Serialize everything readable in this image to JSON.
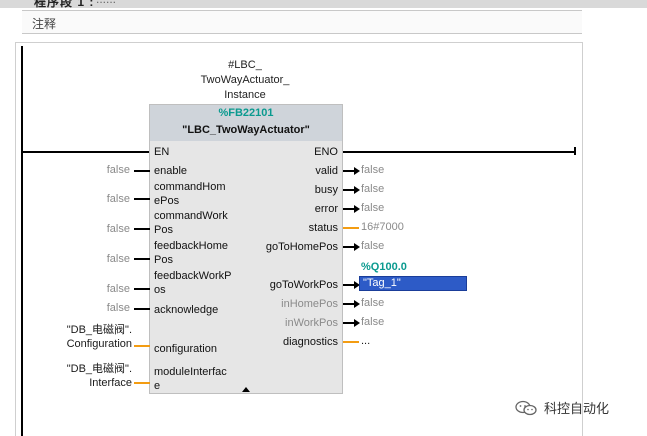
{
  "header": {
    "network_title": "程序段 1 :",
    "network_title_dots": "......",
    "comment_label": "注释"
  },
  "instance": {
    "line1": "#LBC_",
    "line2": "TwoWayActuator_",
    "line3": "Instance"
  },
  "block": {
    "number": "%FB22101",
    "type_name": "\"LBC_TwoWayActuator\"",
    "en_label": "EN",
    "eno_label": "ENO"
  },
  "inputs": [
    {
      "value": "false",
      "pin": [
        "enable"
      ]
    },
    {
      "value": "false",
      "pin": [
        "commandHom",
        "ePos"
      ]
    },
    {
      "value": "false",
      "pin": [
        "commandWork",
        "Pos"
      ]
    },
    {
      "value": "false",
      "pin": [
        "feedbackHome",
        "Pos"
      ]
    },
    {
      "value": "false",
      "pin": [
        "feedbackWorkP",
        "os"
      ]
    },
    {
      "value": "false",
      "pin": [
        "acknowledge"
      ]
    },
    {
      "value": [
        "\"DB_电磁阀\".",
        "Configuration"
      ],
      "pin": [
        "configuration"
      ]
    },
    {
      "value": [
        "\"DB_电磁阀\".",
        "Interface"
      ],
      "pin": [
        "moduleInterfac",
        "e"
      ]
    }
  ],
  "outputs": [
    {
      "pin": "valid",
      "value": "false"
    },
    {
      "pin": "busy",
      "value": "false"
    },
    {
      "pin": "error",
      "value": "false"
    },
    {
      "pin": "status",
      "value": "16#7000"
    },
    {
      "pin": "goToHomePos",
      "value": "false"
    },
    {
      "pin": "goToWorkPos",
      "address": "%Q100.0",
      "value": "\"Tag_1\""
    },
    {
      "pin": "inHomePos",
      "value": "false"
    },
    {
      "pin": "inWorkPos",
      "value": "false"
    },
    {
      "pin": "diagnostics",
      "value": "..."
    }
  ],
  "watermark": {
    "text": "科控自动化"
  },
  "colors": {
    "teal": "#0a9a8f",
    "orange_wire": "#f39c12",
    "selection": "#2d5bc7"
  }
}
